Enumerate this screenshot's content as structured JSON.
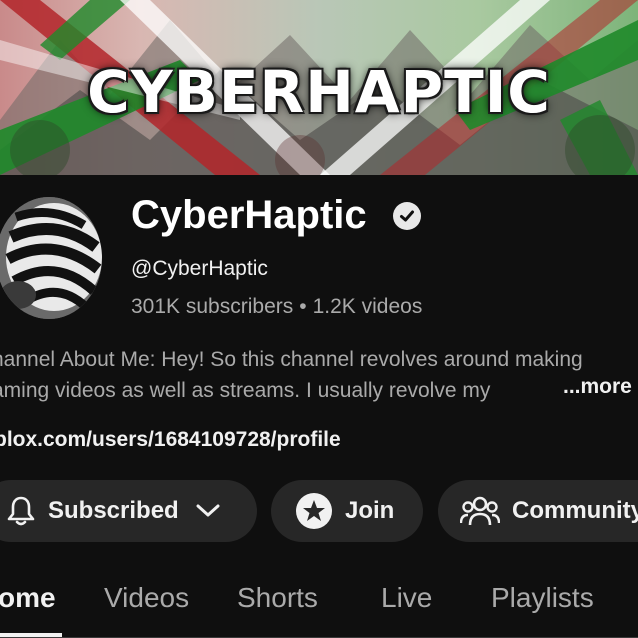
{
  "banner": {
    "title": "CYBERHAPTIC"
  },
  "channel": {
    "name": "CyberHaptic",
    "handle": "@CyberHaptic",
    "subscribers": "301K subscribers",
    "stats_separator": "•",
    "videos": "1.2K videos",
    "verified_icon": "verified-check-icon"
  },
  "description": {
    "line1": "hannel About Me: Hey! So this channel revolves around making",
    "line2": "aming videos as well as streams. I usually revolve my",
    "more_label": "...more"
  },
  "link": {
    "text": "blox.com/users/1684109728/profile"
  },
  "actions": {
    "subscribed_label": "Subscribed",
    "join_label": "Join",
    "community_label": "Community"
  },
  "tabs": [
    {
      "label": "ome",
      "active": true
    },
    {
      "label": "Videos",
      "active": false
    },
    {
      "label": "Shorts",
      "active": false
    },
    {
      "label": "Live",
      "active": false
    },
    {
      "label": "Playlists",
      "active": false
    }
  ],
  "colors": {
    "background": "#0f0f0f",
    "button_bg": "#272727",
    "secondary_text": "#aaaaaa",
    "primary_text": "#f1f1f1"
  }
}
